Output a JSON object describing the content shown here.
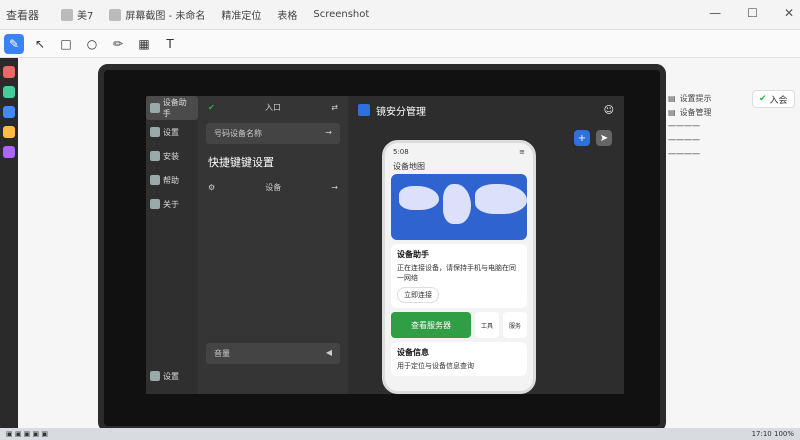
{
  "window": {
    "app_title": "查看器",
    "tabs": [
      {
        "label": "美7"
      },
      {
        "label": "屏幕截图 - 未命名"
      }
    ],
    "controls": [
      "—",
      "☐",
      "✕"
    ]
  },
  "toolbar": {
    "tabs": [
      "精准定位",
      "表格",
      "Screenshot"
    ],
    "text_tool": "T"
  },
  "app": {
    "nav": [
      {
        "label": "设备助手"
      },
      {
        "label": "设置"
      },
      {
        "label": "安装"
      },
      {
        "label": "帮助"
      },
      {
        "label": "关于"
      }
    ],
    "bottom_nav": "设置",
    "panel": {
      "title": "快捷键键设置",
      "login": "入口",
      "search": "号码设备名称",
      "item": "设备",
      "bottom": "音量"
    },
    "brand": "镜安分管理",
    "phone": {
      "status": "5:08",
      "app_title": "设备地图",
      "card_title": "设备助手",
      "card_sub": "正在连接设备，请保持手机与电脑在同一网络",
      "chip": "立即连接",
      "big_btn": "查看服务器",
      "small_btns": [
        "工具",
        "服务"
      ],
      "bottom_title": "设备信息",
      "bottom_sub": "用于定位与设备信息查询"
    }
  },
  "right": {
    "lines": [
      "设置提示",
      "设备管理",
      "一一一一",
      "一一一一",
      "一一一一"
    ],
    "join_label": "入会"
  },
  "status": {
    "time": "17:10",
    "battery": "100%"
  }
}
